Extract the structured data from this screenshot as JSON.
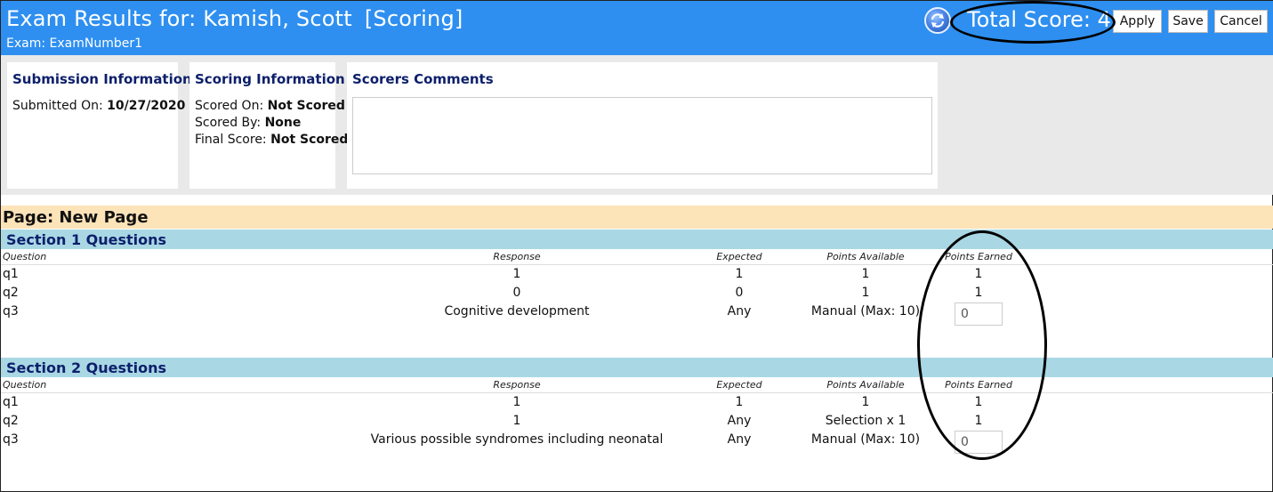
{
  "header": {
    "title": "Exam Results for: Kamish, Scott",
    "status_tag": "[Scoring]",
    "subtitle": "Exam: ExamNumber1",
    "total_score": "Total Score: 4",
    "apply_label": "Apply",
    "save_label": "Save",
    "cancel_label": "Cancel",
    "refresh_icon": "refresh-icon"
  },
  "submission": {
    "heading": "Submission Information",
    "submitted_label": "Submitted On:",
    "submitted_value": "10/27/2020"
  },
  "scoring": {
    "heading": "Scoring Information",
    "scored_on_label": "Scored On:",
    "scored_on_value": "Not Scored",
    "scored_by_label": "Scored By:",
    "scored_by_value": "None",
    "final_label": "Final Score:",
    "final_value": "Not Scored"
  },
  "comments": {
    "heading": "Scorers Comments",
    "value": ""
  },
  "page": {
    "title": "Page: New Page"
  },
  "columns": {
    "question": "Question",
    "response": "Response",
    "expected": "Expected",
    "points_available": "Points Available",
    "points_earned": "Points Earned"
  },
  "sections": [
    {
      "title": "Section 1 Questions",
      "rows": [
        {
          "q": "q1",
          "response": "1",
          "expected": "1",
          "available": "1",
          "earned": "1"
        },
        {
          "q": "q2",
          "response": "0",
          "expected": "0",
          "available": "1",
          "earned": "1"
        },
        {
          "q": "q3",
          "response": "Cognitive development",
          "expected": "Any",
          "available": "Manual (Max: 10)",
          "earned_input": "0"
        }
      ]
    },
    {
      "title": "Section 2 Questions",
      "rows": [
        {
          "q": "q1",
          "response": "1",
          "expected": "1",
          "available": "1",
          "earned": "1"
        },
        {
          "q": "q2",
          "response": "1",
          "expected": "Any",
          "available": "Selection x 1",
          "earned": "1"
        },
        {
          "q": "q3",
          "response": "Various possible syndromes including neonatal",
          "expected": "Any",
          "available": "Manual (Max: 10)",
          "earned_input": "0"
        }
      ]
    }
  ],
  "colors": {
    "header_bg": "#2e8ff0",
    "page_bar": "#fde3b8",
    "section_bar": "#a9d8e4",
    "heading_text": "#0d1f6b"
  }
}
